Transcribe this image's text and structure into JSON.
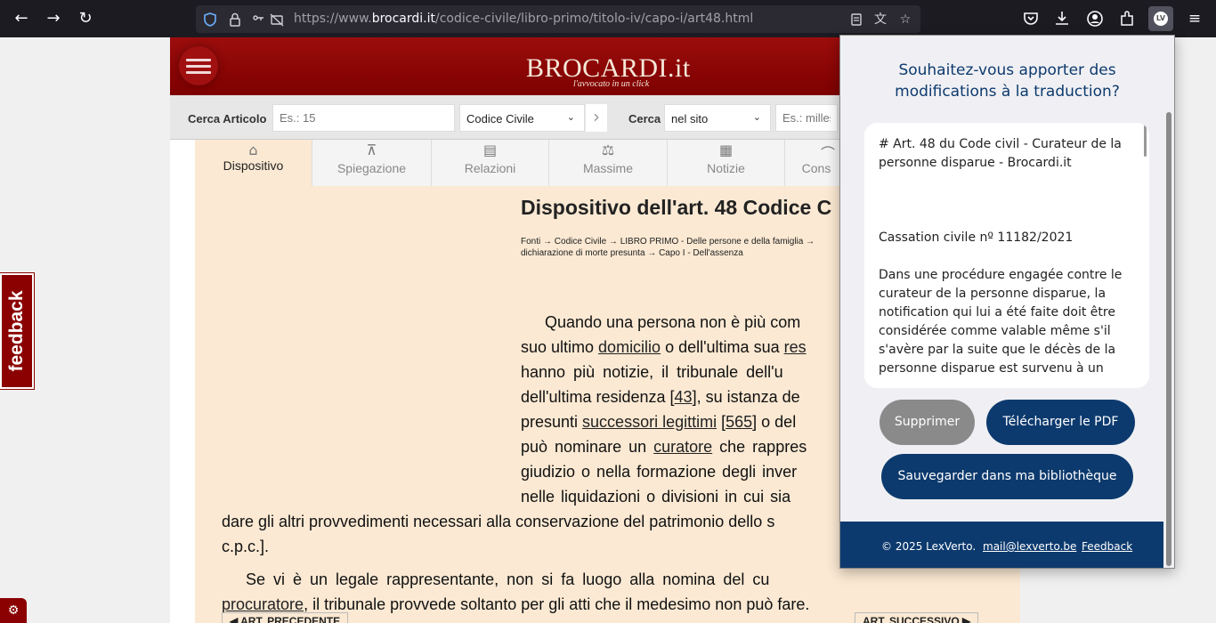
{
  "browser": {
    "url_prefix": "https://www.",
    "url_host": "brocardi.it",
    "url_path": "/codice-civile/libro-primo/titolo-iv/capo-i/art48.html",
    "back_glyph": "←",
    "forward_glyph": "→",
    "reload_glyph": "↻",
    "extension_badge": "LV"
  },
  "site": {
    "logo": "BROCARDI.it",
    "tagline": "l'avvocato in un click"
  },
  "search": {
    "cerca_articolo_label": "Cerca Articolo",
    "articolo_placeholder": "Es.: 15",
    "codice_select": "Codice Civile",
    "cerca_label": "Cerca",
    "scope_select": "nel sito",
    "query_placeholder": "Es.: millesi"
  },
  "tabs": [
    {
      "label": "Dispositivo"
    },
    {
      "label": "Spiegazione"
    },
    {
      "label": "Relazioni"
    },
    {
      "label": "Massime"
    },
    {
      "label": "Notizie"
    },
    {
      "label": "Cons"
    }
  ],
  "article": {
    "title": "Dispositivo dell'art. 48 Codice C",
    "breadcrumb_line1": "Fonti → Codice Civile → LIBRO PRIMO - Delle persone e della famiglia →",
    "breadcrumb_line2": "dichiarazione di morte presunta → Capo I - Dell'assenza",
    "p1_l1": "Quando una persona non è più com",
    "p1_l2a": "suo ultimo ",
    "p1_l2_link": "domicilio",
    "p1_l2b": " o dell'ultima sua ",
    "p1_l2_link2": "res",
    "p1_l3": "hanno più notizie, il tribunale dell'u",
    "p1_l4a": "dell'ultima residenza [",
    "p1_l4_ref": "43",
    "p1_l4b": "], su istanza de",
    "p1_l5a": "presunti ",
    "p1_l5_link": "successori legittimi",
    "p1_l5b": " [",
    "p1_l5_ref": "565",
    "p1_l5c": "] o del",
    "p1_l6a": "può nominare un ",
    "p1_l6_link": "curatore",
    "p1_l6b": " che rappres",
    "p1_l7": "giudizio o nella formazione degli inver",
    "p1_l8": "nelle liquidazioni o divisioni in cui sia",
    "p1_l9": "dare gli altri provvedimenti necessari alla conservazione del patrimonio dello s",
    "p1_l10": "c.p.c.].",
    "p2_l1": "Se vi è un legale rappresentante, non si fa luogo alla nomina del cu",
    "p2_l2_link": "procuratore",
    "p2_l2b": ", il tribunale provvede soltanto per gli atti che il medesimo non può fare.",
    "prev_label": "◀ ART. PRECEDENTE",
    "next_label": "ART. SUCCESSIVO ▶"
  },
  "feedback_tab": "feedback",
  "popup": {
    "title": "Souhaitez-vous apporter des modifications à la traduction?",
    "text": "# Art. 48 du Code civil - Curateur de la personne disparue - Brocardi.it\n\n\n\nCassation civile nº 11182/2021\n\nDans une procédure engagée contre le curateur de la personne disparue, la notification qui lui a été faite doit être considérée comme valable même s'il s'avère par la suite que le décès de la personne disparue est survenu à un",
    "delete_label": "Supprimer",
    "download_label": "Télécharger le PDF",
    "save_label": "Sauvegarder dans ma bibliothèque",
    "copyright": "© 2025 LexVerto.",
    "email": "mail@lexverto.be",
    "feedback": "Feedback"
  }
}
